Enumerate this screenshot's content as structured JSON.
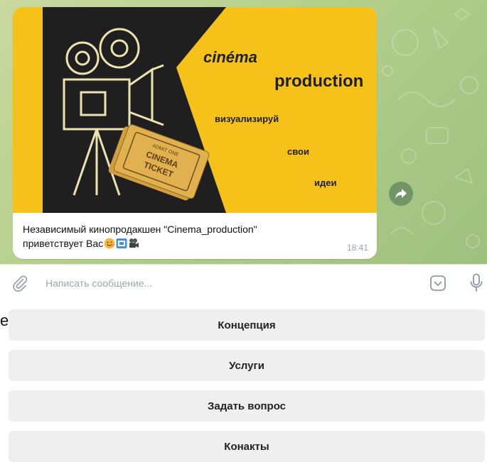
{
  "poster": {
    "line1": "cinéma",
    "line2": "production",
    "line3": "визуализируй",
    "line4": "свои",
    "line5": "идеи",
    "ticket_top": "ADMIT ONE",
    "ticket_main1": "CINEMA",
    "ticket_main2": "TICKET",
    "colors": {
      "yellow": "#f6c21a",
      "dark": "#1f1f1f",
      "chalk": "#ece3b0",
      "ticket": "#e2b14f"
    }
  },
  "message": {
    "text_line1": "Независимый кинопродакшен \"Cinema_production\"",
    "text_line2": "приветствует Вас",
    "time": "18:41",
    "emoji": [
      "smiling-face-icon",
      "film-frames-icon",
      "movie-camera-icon"
    ]
  },
  "composer": {
    "placeholder": "Написать сообщение...",
    "icons": [
      "paperclip-icon",
      "emoji-panel-icon",
      "microphone-icon"
    ]
  },
  "edge_char": "е",
  "keyboard": {
    "buttons": [
      "Концепция",
      "Услуги",
      "Задать вопрос",
      "Конакты"
    ]
  },
  "colors": {
    "chat_bg": "#b3cf8c",
    "accent": "#5b8a5f"
  }
}
